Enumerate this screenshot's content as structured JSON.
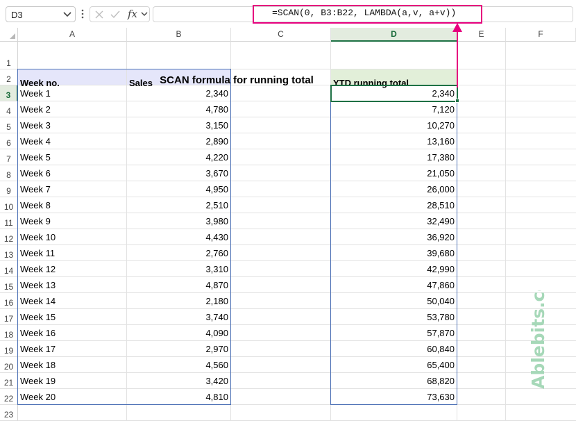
{
  "formula_bar": {
    "name_box": "D3",
    "fx_label": "fx",
    "formula": "=SCAN(0, B3:B22, LAMBDA(a,v, a+v))"
  },
  "columns": [
    "A",
    "B",
    "C",
    "D",
    "E",
    "F"
  ],
  "rows": [
    "1",
    "2",
    "3",
    "4",
    "5",
    "6",
    "7",
    "8",
    "9",
    "10",
    "11",
    "12",
    "13",
    "14",
    "15",
    "16",
    "17",
    "18",
    "19",
    "20",
    "21",
    "22",
    "23"
  ],
  "sheet": {
    "title": "SCAN formula for running total",
    "headers": {
      "week": "Week no.",
      "sales": "Sales",
      "ytd": "YTD running total"
    },
    "data": [
      {
        "week": "Week 1",
        "sales": "2,340",
        "ytd": "2,340"
      },
      {
        "week": "Week 2",
        "sales": "4,780",
        "ytd": "7,120"
      },
      {
        "week": "Week 3",
        "sales": "3,150",
        "ytd": "10,270"
      },
      {
        "week": "Week 4",
        "sales": "2,890",
        "ytd": "13,160"
      },
      {
        "week": "Week 5",
        "sales": "4,220",
        "ytd": "17,380"
      },
      {
        "week": "Week 6",
        "sales": "3,670",
        "ytd": "21,050"
      },
      {
        "week": "Week 7",
        "sales": "4,950",
        "ytd": "26,000"
      },
      {
        "week": "Week 8",
        "sales": "2,510",
        "ytd": "28,510"
      },
      {
        "week": "Week 9",
        "sales": "3,980",
        "ytd": "32,490"
      },
      {
        "week": "Week 10",
        "sales": "4,430",
        "ytd": "36,920"
      },
      {
        "week": "Week 11",
        "sales": "2,760",
        "ytd": "39,680"
      },
      {
        "week": "Week 12",
        "sales": "3,310",
        "ytd": "42,990"
      },
      {
        "week": "Week 13",
        "sales": "4,870",
        "ytd": "47,860"
      },
      {
        "week": "Week 14",
        "sales": "2,180",
        "ytd": "50,040"
      },
      {
        "week": "Week 15",
        "sales": "3,740",
        "ytd": "53,780"
      },
      {
        "week": "Week 16",
        "sales": "4,090",
        "ytd": "57,870"
      },
      {
        "week": "Week 17",
        "sales": "2,970",
        "ytd": "60,840"
      },
      {
        "week": "Week 18",
        "sales": "4,560",
        "ytd": "65,400"
      },
      {
        "week": "Week 19",
        "sales": "3,420",
        "ytd": "68,820"
      },
      {
        "week": "Week 20",
        "sales": "4,810",
        "ytd": "73,630"
      }
    ]
  },
  "selection": {
    "active_cell": "D3",
    "selected_column": "D",
    "selected_row": "3"
  },
  "watermark": "Ablebits.com",
  "colors": {
    "accent_green": "#1e7145",
    "header_fill_ab": "#e5e6fa",
    "header_fill_d": "#e2efd9",
    "range_border": "#4a6fb5",
    "callout_pink": "#e6007e",
    "watermark": "#a6d8b8"
  },
  "icons": {
    "name_box_dropdown": "chevron-down-icon",
    "more": "vertical-dots-icon",
    "cancel": "x-icon",
    "enter": "check-icon",
    "insert_function": "fx-icon",
    "callout": "arrow-up-icon"
  }
}
